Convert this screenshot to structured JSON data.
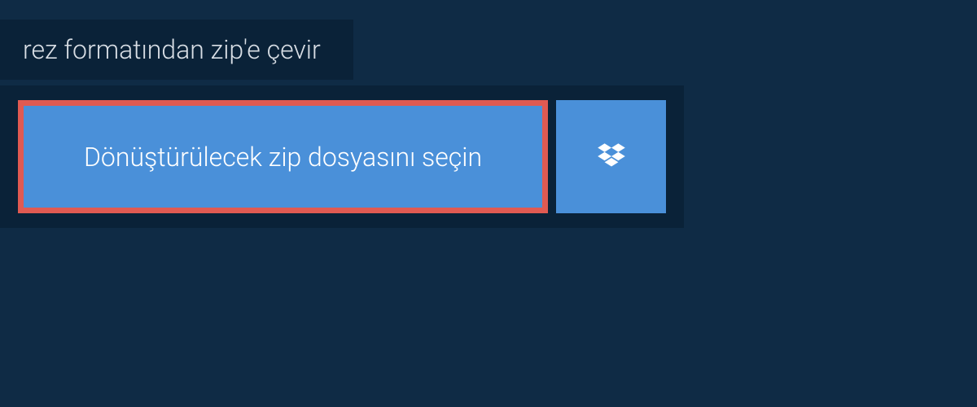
{
  "tab": {
    "label": "rez formatından zip'e çevir"
  },
  "upload": {
    "select_label": "Dönüştürülecek zip dosyasını seçin"
  },
  "colors": {
    "background": "#0f2b45",
    "panel": "#0a2238",
    "button": "#4a90d9",
    "highlight_border": "#e05a52"
  }
}
